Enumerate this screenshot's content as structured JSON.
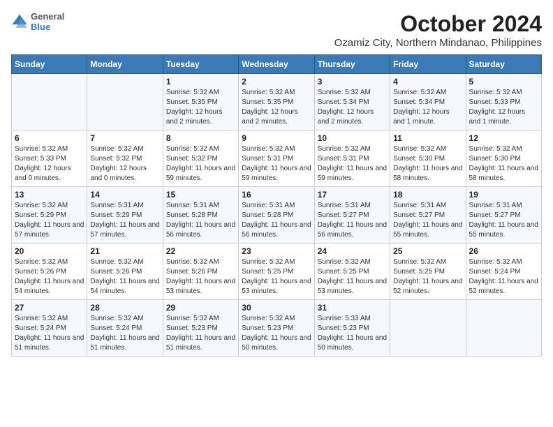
{
  "header": {
    "logo": {
      "line1": "General",
      "line2": "Blue"
    },
    "title": "October 2024",
    "subtitle": "Ozamiz City, Northern Mindanao, Philippines"
  },
  "days_of_week": [
    "Sunday",
    "Monday",
    "Tuesday",
    "Wednesday",
    "Thursday",
    "Friday",
    "Saturday"
  ],
  "weeks": [
    [
      {
        "day": "",
        "info": ""
      },
      {
        "day": "",
        "info": ""
      },
      {
        "day": "1",
        "info": "Sunrise: 5:32 AM\nSunset: 5:35 PM\nDaylight: 12 hours and 2 minutes."
      },
      {
        "day": "2",
        "info": "Sunrise: 5:32 AM\nSunset: 5:35 PM\nDaylight: 12 hours and 2 minutes."
      },
      {
        "day": "3",
        "info": "Sunrise: 5:32 AM\nSunset: 5:34 PM\nDaylight: 12 hours and 2 minutes."
      },
      {
        "day": "4",
        "info": "Sunrise: 5:32 AM\nSunset: 5:34 PM\nDaylight: 12 hours and 1 minute."
      },
      {
        "day": "5",
        "info": "Sunrise: 5:32 AM\nSunset: 5:33 PM\nDaylight: 12 hours and 1 minute."
      }
    ],
    [
      {
        "day": "6",
        "info": "Sunrise: 5:32 AM\nSunset: 5:33 PM\nDaylight: 12 hours and 0 minutes."
      },
      {
        "day": "7",
        "info": "Sunrise: 5:32 AM\nSunset: 5:32 PM\nDaylight: 12 hours and 0 minutes."
      },
      {
        "day": "8",
        "info": "Sunrise: 5:32 AM\nSunset: 5:32 PM\nDaylight: 11 hours and 59 minutes."
      },
      {
        "day": "9",
        "info": "Sunrise: 5:32 AM\nSunset: 5:31 PM\nDaylight: 11 hours and 59 minutes."
      },
      {
        "day": "10",
        "info": "Sunrise: 5:32 AM\nSunset: 5:31 PM\nDaylight: 11 hours and 59 minutes."
      },
      {
        "day": "11",
        "info": "Sunrise: 5:32 AM\nSunset: 5:30 PM\nDaylight: 11 hours and 58 minutes."
      },
      {
        "day": "12",
        "info": "Sunrise: 5:32 AM\nSunset: 5:30 PM\nDaylight: 11 hours and 58 minutes."
      }
    ],
    [
      {
        "day": "13",
        "info": "Sunrise: 5:32 AM\nSunset: 5:29 PM\nDaylight: 11 hours and 57 minutes."
      },
      {
        "day": "14",
        "info": "Sunrise: 5:31 AM\nSunset: 5:29 PM\nDaylight: 11 hours and 57 minutes."
      },
      {
        "day": "15",
        "info": "Sunrise: 5:31 AM\nSunset: 5:28 PM\nDaylight: 11 hours and 56 minutes."
      },
      {
        "day": "16",
        "info": "Sunrise: 5:31 AM\nSunset: 5:28 PM\nDaylight: 11 hours and 56 minutes."
      },
      {
        "day": "17",
        "info": "Sunrise: 5:31 AM\nSunset: 5:27 PM\nDaylight: 11 hours and 56 minutes."
      },
      {
        "day": "18",
        "info": "Sunrise: 5:31 AM\nSunset: 5:27 PM\nDaylight: 11 hours and 55 minutes."
      },
      {
        "day": "19",
        "info": "Sunrise: 5:31 AM\nSunset: 5:27 PM\nDaylight: 11 hours and 55 minutes."
      }
    ],
    [
      {
        "day": "20",
        "info": "Sunrise: 5:32 AM\nSunset: 5:26 PM\nDaylight: 11 hours and 54 minutes."
      },
      {
        "day": "21",
        "info": "Sunrise: 5:32 AM\nSunset: 5:26 PM\nDaylight: 11 hours and 54 minutes."
      },
      {
        "day": "22",
        "info": "Sunrise: 5:32 AM\nSunset: 5:26 PM\nDaylight: 11 hours and 53 minutes."
      },
      {
        "day": "23",
        "info": "Sunrise: 5:32 AM\nSunset: 5:25 PM\nDaylight: 11 hours and 53 minutes."
      },
      {
        "day": "24",
        "info": "Sunrise: 5:32 AM\nSunset: 5:25 PM\nDaylight: 11 hours and 53 minutes."
      },
      {
        "day": "25",
        "info": "Sunrise: 5:32 AM\nSunset: 5:25 PM\nDaylight: 11 hours and 52 minutes."
      },
      {
        "day": "26",
        "info": "Sunrise: 5:32 AM\nSunset: 5:24 PM\nDaylight: 11 hours and 52 minutes."
      }
    ],
    [
      {
        "day": "27",
        "info": "Sunrise: 5:32 AM\nSunset: 5:24 PM\nDaylight: 11 hours and 51 minutes."
      },
      {
        "day": "28",
        "info": "Sunrise: 5:32 AM\nSunset: 5:24 PM\nDaylight: 11 hours and 51 minutes."
      },
      {
        "day": "29",
        "info": "Sunrise: 5:32 AM\nSunset: 5:23 PM\nDaylight: 11 hours and 51 minutes."
      },
      {
        "day": "30",
        "info": "Sunrise: 5:32 AM\nSunset: 5:23 PM\nDaylight: 11 hours and 50 minutes."
      },
      {
        "day": "31",
        "info": "Sunrise: 5:33 AM\nSunset: 5:23 PM\nDaylight: 11 hours and 50 minutes."
      },
      {
        "day": "",
        "info": ""
      },
      {
        "day": "",
        "info": ""
      }
    ]
  ]
}
